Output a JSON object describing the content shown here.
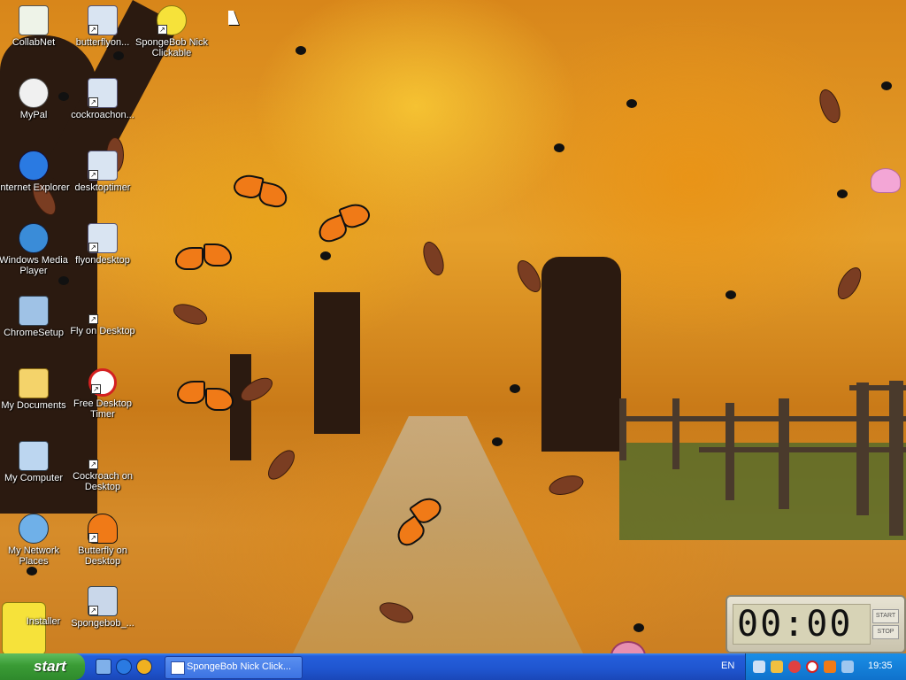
{
  "desktop": {
    "icons": [
      {
        "label": "CollabNet",
        "icon": "collabnet-icon"
      },
      {
        "label": "butterflyon...",
        "icon": "setup-icon"
      },
      {
        "label": "SpongeBob Nick Clickable",
        "icon": "spongebob-icon"
      },
      {
        "label": "MyPal",
        "icon": "mypal-icon"
      },
      {
        "label": "cockroachon...",
        "icon": "setup-icon"
      },
      {
        "label": "Internet Explorer",
        "icon": "internet-explorer-icon"
      },
      {
        "label": "desktoptimer",
        "icon": "setup-icon"
      },
      {
        "label": "Windows Media Player",
        "icon": "media-player-icon"
      },
      {
        "label": "flyondesktop",
        "icon": "setup-icon"
      },
      {
        "label": "ChromeSetup",
        "icon": "chrome-setup-icon"
      },
      {
        "label": "Fly on Desktop",
        "icon": "fly-icon"
      },
      {
        "label": "My Documents",
        "icon": "folder-icon"
      },
      {
        "label": "Free Desktop Timer",
        "icon": "timer-clock-icon"
      },
      {
        "label": "My Computer",
        "icon": "computer-icon"
      },
      {
        "label": "Cockroach on Desktop",
        "icon": "cockroach-icon"
      },
      {
        "label": "My Network Places",
        "icon": "network-icon"
      },
      {
        "label": "Butterfly on Desktop",
        "icon": "butterfly-icon"
      },
      {
        "label": "Installer",
        "icon": "installer-icon"
      },
      {
        "label": "Spongebob_...",
        "icon": "installer-icon"
      }
    ]
  },
  "timer_widget": {
    "display": "00:00",
    "start_label": "START",
    "stop_label": "STOP"
  },
  "taskbar": {
    "start_label": "start",
    "quick_launch": [
      "show-desktop-icon",
      "internet-explorer-icon",
      "media-player-icon"
    ],
    "task_button_label": "SpongeBob Nick Click...",
    "language": "EN",
    "clock": "19:35"
  },
  "colors": {
    "taskbar_blue": "#245edb",
    "start_green": "#3a9b35",
    "tray_blue": "#0f72cc",
    "butterfly_orange": "#f07a17"
  }
}
